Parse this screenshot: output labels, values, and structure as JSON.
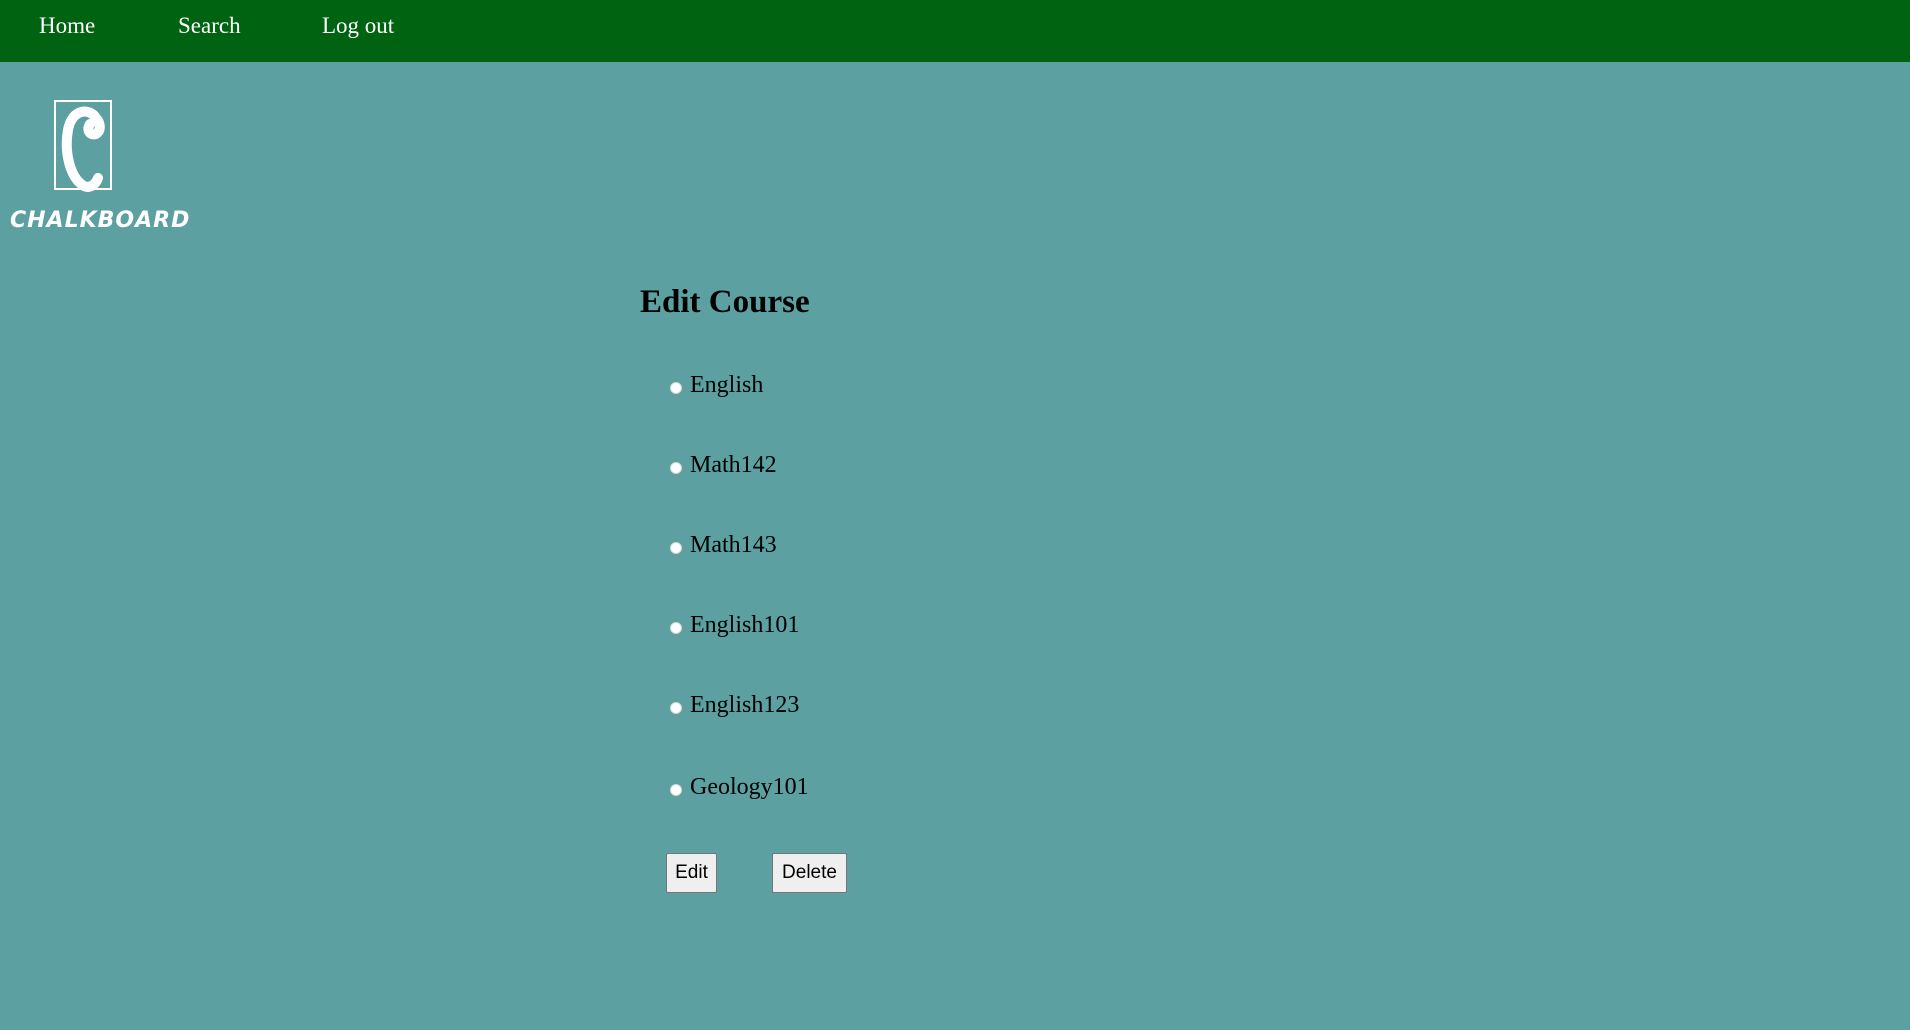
{
  "nav": {
    "home": "Home",
    "search": "Search",
    "logout": "Log out"
  },
  "logo": {
    "letter": "C",
    "text": "CHALKBOARD"
  },
  "page": {
    "title": "Edit Course"
  },
  "courses": [
    {
      "label": "English"
    },
    {
      "label": "Math142"
    },
    {
      "label": "Math143"
    },
    {
      "label": "English101"
    },
    {
      "label": "English123"
    },
    {
      "label": "Geology101"
    }
  ],
  "buttons": {
    "edit": "Edit",
    "delete": "Delete"
  },
  "colors": {
    "nav_bg": "#006311",
    "page_bg": "#5ca0a2"
  }
}
